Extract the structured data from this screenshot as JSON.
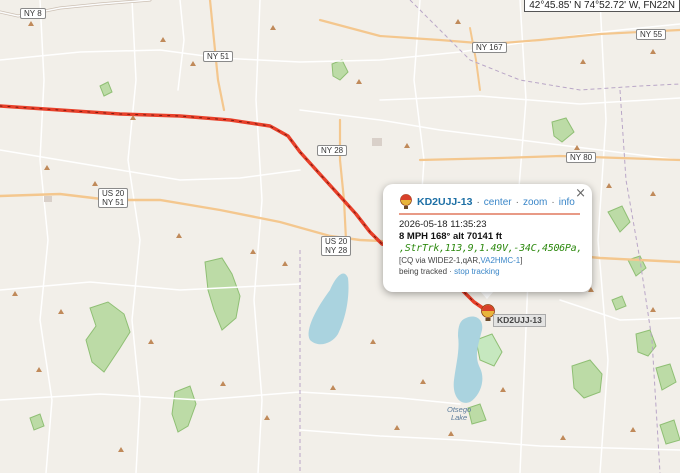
{
  "map": {
    "coordinate_readout": "42°45.85' N 74°52.72' W, FN22N",
    "route_shields": [
      {
        "id": "ny8",
        "text": "NY 8"
      },
      {
        "id": "ny51a",
        "text": "NY 51"
      },
      {
        "id": "ny167",
        "text": "NY 167"
      },
      {
        "id": "ny55",
        "text": "NY 55"
      },
      {
        "id": "ny28a",
        "text": "NY 28"
      },
      {
        "id": "ny80",
        "text": "NY 80"
      },
      {
        "id": "us20a",
        "text": "US 20\nNY 51"
      },
      {
        "id": "us20b",
        "text": "US 20\nNY 28"
      }
    ],
    "lake_label": "Otsego\nLake",
    "colors": {
      "track": "#e8402a",
      "track_dash": "#7a1a10",
      "water": "#aad3df",
      "forest": "#a8cf8f",
      "road": "#ffffff",
      "major_road": "#f4c78e"
    }
  },
  "popup": {
    "icon": "balloon-icon",
    "callsign": "KD2UJJ-13",
    "separator": "·",
    "links": {
      "center": "center",
      "zoom": "zoom",
      "info": "info"
    },
    "close": "×",
    "timestamp": "2026-05-18 11:35:23",
    "speed_line": "8 MPH 168° alt 70141 ft",
    "comment": ",StrTrk,113,9,1.49V,-34C,4506Pa,",
    "path_prefix": "[CQ via WIDE2-1,qAR,",
    "path_link": "VA2HMC-1",
    "path_suffix": "]",
    "tracking_text": "being tracked",
    "stop_link": "stop tracking"
  },
  "station_label": "KD2UJJ-13"
}
